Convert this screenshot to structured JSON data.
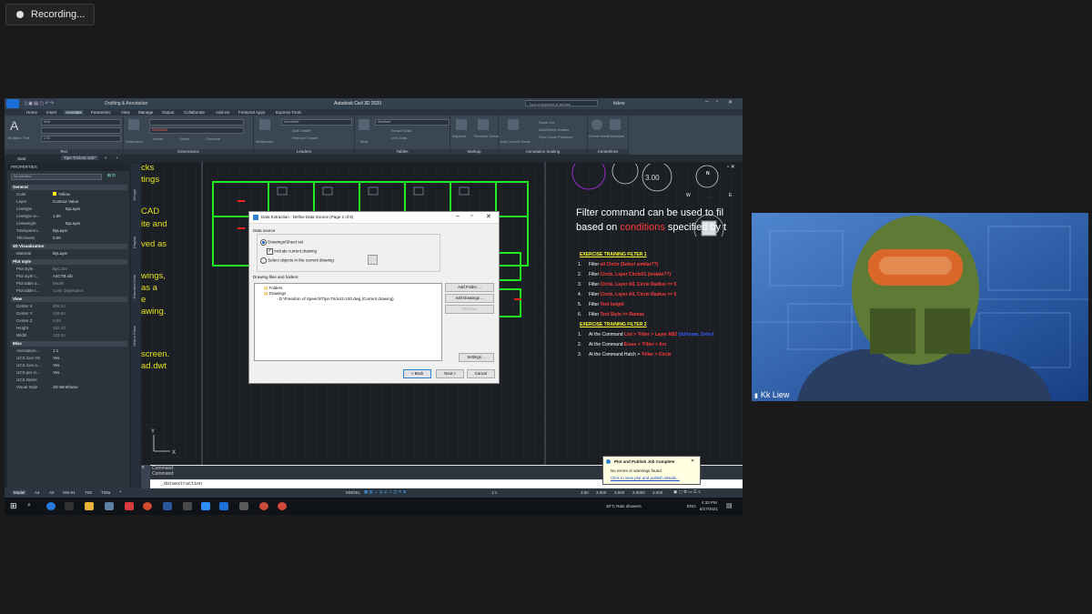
{
  "recording": {
    "label": "Recording..."
  },
  "app": {
    "title": "Autodesk Civil 3D 2020",
    "workspace": "Drafting & Annotation",
    "search_placeholder": "Type a keyword or phrase",
    "user": "kklew"
  },
  "ribbon_tabs": [
    "Home",
    "Insert",
    "Annotate",
    "Parametric",
    "View",
    "Manage",
    "Output",
    "Collaborate",
    "Add-ins",
    "Featured Apps",
    "Express Tools"
  ],
  "ribbon": {
    "text": {
      "label": "Text",
      "font": "Arial",
      "size": "2.00",
      "button": "Multiline Text"
    },
    "dimensions": {
      "label": "Dimensions",
      "button": "Dimension",
      "layer": "MGENDIM",
      "items": [
        "Linear",
        "Quick",
        "Continue"
      ]
    },
    "leaders": {
      "label": "Leaders",
      "style": "Annotative",
      "button": "Multileader",
      "items": [
        "Add Leader",
        "Remove Leader"
      ]
    },
    "tables": {
      "label": "Tables",
      "style": "Standard",
      "button": "Table",
      "items": [
        "Extract Data",
        "Link Data"
      ]
    },
    "markup": {
      "label": "Markup",
      "items": [
        "Wipeout",
        "Revision Cloud"
      ]
    },
    "annotation_scaling": {
      "label": "Annotation Scaling",
      "button": "Add Current Scale",
      "items": [
        "Scale List",
        "Add/Delete Scales",
        "Sync Scale Positions"
      ]
    },
    "centerlines": {
      "label": "Centerlines",
      "items": [
        "Center Mark",
        "Centerline"
      ]
    }
  },
  "file_tabs": [
    "Start",
    "Tips-Trick42-100*"
  ],
  "properties": {
    "header": "PROPERTIES",
    "selection": "No selection",
    "sections": [
      {
        "name": "General",
        "rows": [
          [
            "Color",
            "Yellow"
          ],
          [
            "Layer",
            "Contour Value"
          ],
          [
            "Linetype",
            "ByLayer"
          ],
          [
            "Linetype sc...",
            "1.00"
          ],
          [
            "Lineweight",
            "ByLayer"
          ],
          [
            "Transparen...",
            "ByLayer"
          ],
          [
            "Thickness",
            "0.00"
          ]
        ]
      },
      {
        "name": "3D Visualization",
        "rows": [
          [
            "Material",
            "ByLayer"
          ]
        ]
      },
      {
        "name": "Plot style",
        "rows": [
          [
            "Plot style",
            "ByColor"
          ],
          [
            "Plot style t...",
            "A4CTB.ctb"
          ],
          [
            "Plot table a...",
            "Model"
          ],
          [
            "Plot table t...",
            "Color dependent"
          ]
        ]
      },
      {
        "name": "View",
        "rows": [
          [
            "Center X",
            "806.24"
          ],
          [
            "Center Y",
            "108.84"
          ],
          [
            "Center Z",
            "0.00"
          ],
          [
            "Height",
            "182.43"
          ],
          [
            "Width",
            "333.91"
          ]
        ]
      },
      {
        "name": "Misc",
        "rows": [
          [
            "Annotation...",
            "1:1"
          ],
          [
            "UCS icon On",
            "Yes"
          ],
          [
            "UCS icon a...",
            "Yes"
          ],
          [
            "UCS per vi...",
            "Yes"
          ],
          [
            "UCS Name",
            ""
          ],
          [
            "Visual Style",
            "2D Wireframe"
          ]
        ]
      }
    ]
  },
  "side_tabs": [
    "Design",
    "Display",
    "Extended Data",
    "Object Class"
  ],
  "left_yellow_text": [
    "cks",
    "tings",
    "CAD",
    "ite and",
    "ved as",
    "wings,",
    "as a",
    "e",
    "awing.",
    "screen.",
    "ad.dwt"
  ],
  "dialog": {
    "title": "Data Extraction - Define Data Source (Page 2 of 8)",
    "group_label": "Data source",
    "option1": "Drawings/Sheet set",
    "checkbox": "Include current drawing",
    "option2": "Select objects in the current drawing",
    "files_label": "Drawing files and folders:",
    "tree_folders": "Folders",
    "tree_drawings": "Drawings",
    "tree_file": "D:\\Freedom of Speech\\Tips-Trick42-100.dwg (Current drawing)",
    "buttons": {
      "add_folder": "Add Folder ...",
      "add_drawings": "Add Drawings ...",
      "remove": "Remove",
      "settings": "Settings ...",
      "back": "< Back",
      "next": "Next >",
      "cancel": "Cancel"
    }
  },
  "notes": {
    "heading_line1": "Filter command can be used to fil",
    "heading_line2_pre": "based on ",
    "heading_line2_red": "conditions",
    "heading_line2_post": " specified by t",
    "viewcube": {
      "top": "TOP",
      "north": "N",
      "east": "E",
      "west": "W",
      "scale": "3.00"
    },
    "exercise1_title": "EXERCISE TRAINING FILTER 1",
    "exercise1": [
      {
        "num": "1.",
        "pre": "Filter ",
        "red": "all Circle (Select similar??)"
      },
      {
        "num": "2.",
        "pre": "Filter ",
        "red": "Circle, Layer Circle01 (isolate??)"
      },
      {
        "num": "3.",
        "pre": "Filter ",
        "red": "Circle, Layer All, Circle Radius <= 5"
      },
      {
        "num": "4.",
        "pre": "Filter ",
        "red": "Circle, Layer All, Circle Radius >= 5"
      },
      {
        "num": "5.",
        "pre": "Filter ",
        "red": "Text height"
      },
      {
        "num": "6.",
        "pre": "Filter ",
        "red": "Text Style >> Romas"
      }
    ],
    "exercise2_title": "EXERCISE TRAINING FILTER 2",
    "exercise2": [
      {
        "num": "1.",
        "pre": "At the Command ",
        "red": "List > 'Filter > Layer AB2",
        "blue": " (ltd/room, Select"
      },
      {
        "num": "2.",
        "pre": "At the Command ",
        "red": "Erase > 'Filter > Arc",
        "blue": ""
      },
      {
        "num": "3.",
        "pre": "At the Command Hatch > ",
        "red": "'Filter > Circle",
        "blue": ""
      }
    ]
  },
  "command": {
    "line1": "Command:",
    "line2": "Command:",
    "input": "_dataextraction"
  },
  "layout_tabs": [
    "Model",
    "A4",
    "A0",
    "SW-01",
    "T29",
    "T29a"
  ],
  "status": {
    "model": "MODEL",
    "scales": [
      "3.50",
      "3.500",
      "3.500",
      "3.5000",
      "3.500"
    ],
    "scale_ratio": "1:1"
  },
  "taskbar": {
    "weather": "30°C  Rain showers",
    "lang": "ENG",
    "time": "4:33 PM",
    "date": "6/17/2021"
  },
  "toast": {
    "title": "Plot and Publish Job Complete",
    "body": "No errors or warnings found",
    "link": "Click to view plot and publish details..."
  },
  "webcam": {
    "name": "Kk Liew"
  },
  "colors": {
    "accent": "#2f80d0",
    "drawing_green": "#22ee22",
    "note_red": "#ff3a3a",
    "yellow": "#e5e01c"
  }
}
